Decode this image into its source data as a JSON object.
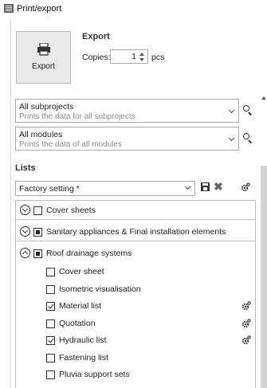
{
  "window": {
    "title": "Print/export",
    "icon": "table-icon"
  },
  "export": {
    "heading": "Export",
    "button_label": "Export",
    "copies_label": "Copies:",
    "copies_value": "1",
    "copies_unit": "pcs"
  },
  "filters": [
    {
      "title": "All subprojects",
      "description": "Prints the data for all subprojects"
    },
    {
      "title": "All modules",
      "description": "Prints the data of all modules"
    }
  ],
  "lists": {
    "heading": "Lists",
    "preset": "Factory setting *",
    "groups": [
      {
        "label": "Cover sheets",
        "expanded": false,
        "state": "unchecked"
      },
      {
        "label": "Sanitary appliances & Final installation elements",
        "expanded": false,
        "state": "partial"
      },
      {
        "label": "Roof drainage systems",
        "expanded": true,
        "state": "partial",
        "items": [
          {
            "label": "Cover sheet",
            "checked": false,
            "settings": false
          },
          {
            "label": "Isometric visualisation",
            "checked": false,
            "settings": false
          },
          {
            "label": "Material list",
            "checked": true,
            "settings": true
          },
          {
            "label": "Quotation",
            "checked": false,
            "settings": true
          },
          {
            "label": "Hydraulic list",
            "checked": true,
            "settings": true
          },
          {
            "label": "Fastening list",
            "checked": false,
            "settings": false
          },
          {
            "label": "Pluvia support sets",
            "checked": false,
            "settings": false
          }
        ]
      }
    ]
  }
}
